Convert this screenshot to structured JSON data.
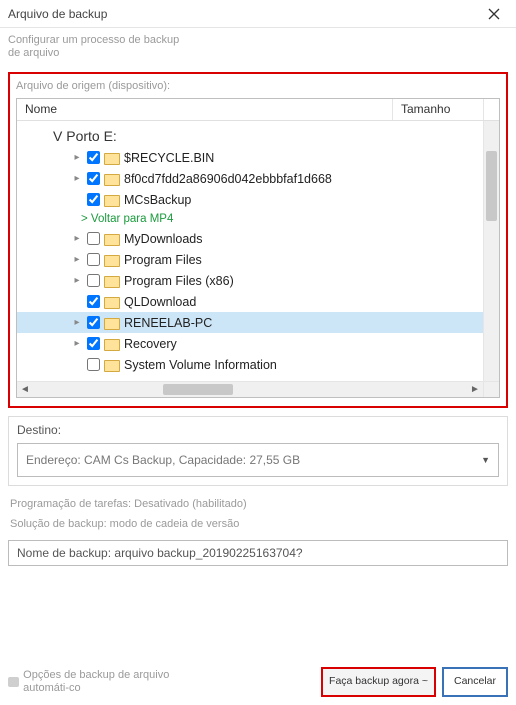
{
  "titlebar": {
    "title": "Arquivo de backup"
  },
  "subhead": "Configurar um processo de backup de arquivo",
  "source": {
    "label": "Arquivo de origem (dispositivo):",
    "columns": {
      "name": "Nome",
      "size": "Tamanho"
    },
    "drive_root": "V Porto E:",
    "back_link": "> Voltar para MP4",
    "items": [
      {
        "name": "$RECYCLE.BIN",
        "checked": true,
        "expander": true,
        "selected": false
      },
      {
        "name": "8f0cd7fdd2a86906d042ebbbfaf1d668",
        "checked": true,
        "expander": true,
        "selected": false
      },
      {
        "name": "MCsBackup",
        "checked": true,
        "expander": false,
        "selected": false
      },
      {
        "name": "MyDownloads",
        "checked": false,
        "expander": true,
        "selected": false
      },
      {
        "name": "Program Files",
        "checked": false,
        "expander": true,
        "selected": false
      },
      {
        "name": "Program Files (x86)",
        "checked": false,
        "expander": true,
        "selected": false
      },
      {
        "name": "QLDownload",
        "checked": true,
        "expander": false,
        "selected": false
      },
      {
        "name": "RENEELAB-PC",
        "checked": true,
        "expander": true,
        "selected": true
      },
      {
        "name": "Recovery",
        "checked": true,
        "expander": true,
        "selected": false
      },
      {
        "name": "System Volume Information",
        "checked": false,
        "expander": false,
        "selected": false
      }
    ]
  },
  "destination": {
    "label": "Destino:",
    "value": "Endereço: CAM Cs Backup, Capacidade: 27,55 GB"
  },
  "schedule": "Programação de tarefas: Desativado (habilitado)",
  "solution": "Solução de backup: modo de cadeia de versão",
  "backup_name": {
    "label_prefix": "Nome de backup: ",
    "value": "arquivo backup_20190225163704?"
  },
  "auto_options": "Opções de backup de arquivo automáti-co",
  "buttons": {
    "backup": "Faça backup agora ~",
    "cancel": "Cancelar"
  }
}
